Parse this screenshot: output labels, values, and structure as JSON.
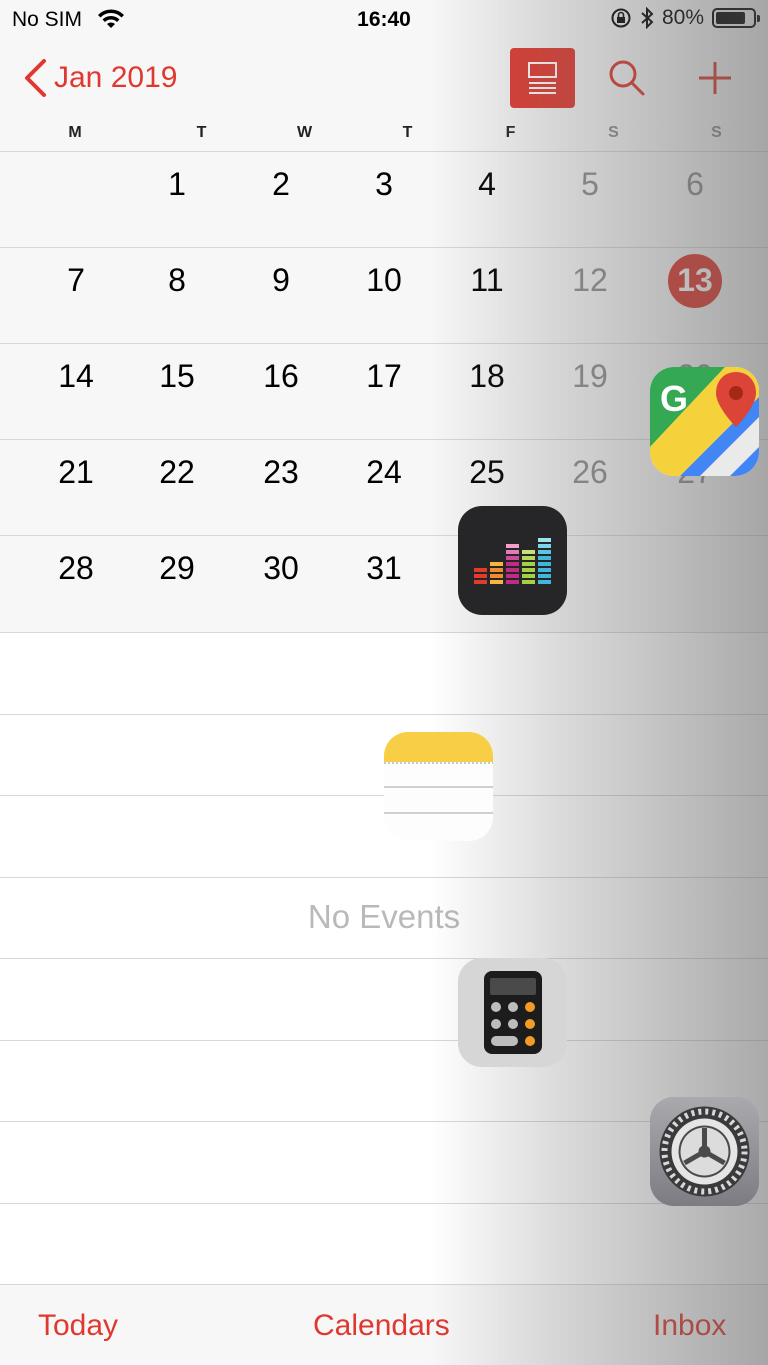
{
  "status": {
    "carrier": "No SIM",
    "time": "16:40",
    "battery": "80%",
    "battery_level": 0.8
  },
  "header": {
    "back_label": "Jan 2019",
    "weekdays": [
      "M",
      "T",
      "W",
      "T",
      "F",
      "S",
      "S"
    ]
  },
  "calendar": {
    "weeks": [
      [
        "",
        "1",
        "2",
        "3",
        "4",
        "5",
        "6"
      ],
      [
        "7",
        "8",
        "9",
        "10",
        "11",
        "12",
        "13"
      ],
      [
        "14",
        "15",
        "16",
        "17",
        "18",
        "19",
        "20"
      ],
      [
        "21",
        "22",
        "23",
        "24",
        "25",
        "26",
        "27"
      ],
      [
        "28",
        "29",
        "30",
        "31",
        "",
        "",
        ""
      ]
    ],
    "today": "13"
  },
  "events": {
    "empty_label": "No Events"
  },
  "tabbar": {
    "today": "Today",
    "calendars": "Calendars",
    "inbox": "Inbox"
  },
  "colors": {
    "accent": "#e0382e"
  },
  "overlay_icons": [
    "google-maps-icon",
    "deezer-icon",
    "notes-icon",
    "calculator-icon",
    "settings-icon"
  ]
}
